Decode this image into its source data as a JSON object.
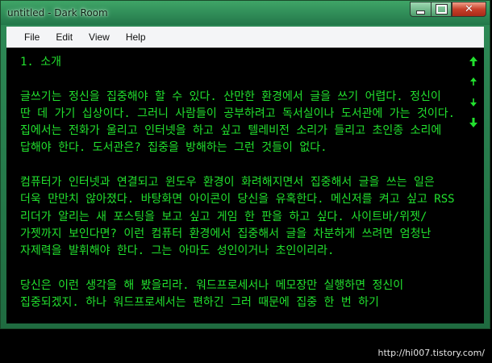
{
  "window": {
    "title": "untitled - Dark Room"
  },
  "menu": {
    "items": [
      "File",
      "Edit",
      "View",
      "Help"
    ]
  },
  "editor": {
    "heading": "1. 소개",
    "paragraphs": [
      "글쓰기는 정신을 집중해야 할 수 있다. 산만한 환경에서 글을 쓰기 어렵다. 정신이 딴 데 가기 십상이다. 그러니 사람들이 공부하려고 독서실이나 도서관에 가는 것이다. 집에서는 전화가 울리고 인터넷을 하고 싶고 텔레비전 소리가 들리고 초인종 소리에 답해야 한다. 도서관은? 집중을 방해하는 그런 것들이 없다.",
      "컴퓨터가 인터넷과 연결되고 윈도우 환경이 화려해지면서 집중해서 글을 쓰는 일은 더욱 만만치 않아졌다. 바탕화면 아이콘이 당신을 유혹한다. 메신저를 켜고 싶고 RSS 리더가 알리는 새 포스팅을 보고 싶고 게임 한 판을 하고 싶다. 사이트바/위젯/가젯까지 보인다면? 이런 컴퓨터 환경에서 집중해서 글을 차분하게 쓰려면 엄청난 자제력을 발휘해야 한다. 그는 아마도 성인이거나 초인이리라.",
      "당신은 이런 생각을 해 봤을리라. 워드프로세서나 메모장만 실행하면 정신이 집중되겠지. 하나 워드프로세서는 편하긴 그러 때문에 집중 한 번 하기"
    ],
    "text_color": "#22e02e",
    "background": "#000000"
  },
  "navigation": {
    "icons": [
      "arrow-top-icon",
      "arrow-up-icon",
      "arrow-down-icon",
      "arrow-bottom-icon"
    ]
  },
  "watermark": "http://hi007.tistory.com/"
}
